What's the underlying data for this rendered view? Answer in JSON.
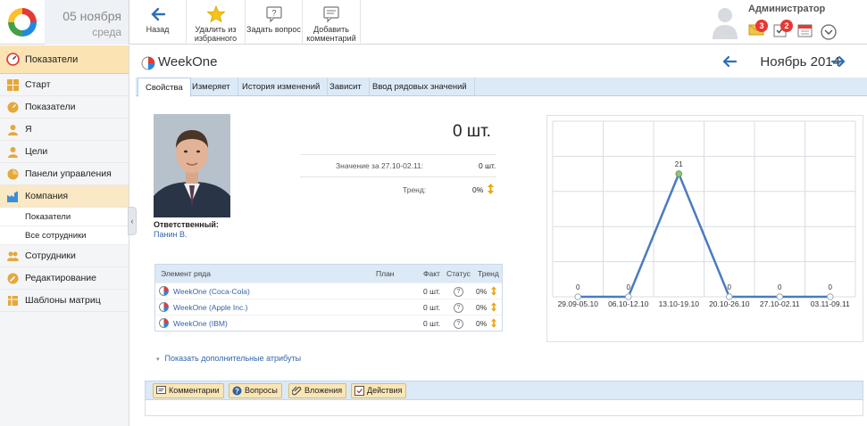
{
  "header": {
    "date": "05 ноября",
    "weekday": "среда",
    "toolbar": {
      "back_label": "Назад",
      "fav_label_1": "Удалить из",
      "fav_label_2": "избранного",
      "ask_label": "Задать вопрос",
      "comment_label_1": "Добавить",
      "comment_label_2": "комментарий"
    },
    "user_name": "Администратор",
    "notifications": {
      "messages": "3",
      "tasks": "2"
    }
  },
  "sidebar": {
    "header": "Показатели",
    "items": [
      {
        "label": "Старт",
        "icon": "grid-icon"
      },
      {
        "label": "Показатели",
        "icon": "gauge-icon"
      },
      {
        "label": "Я",
        "icon": "person-icon"
      },
      {
        "label": "Цели",
        "icon": "target-person-icon"
      },
      {
        "label": "Панели управления",
        "icon": "dashboard-icon"
      },
      {
        "label": "Компания",
        "icon": "factory-icon"
      },
      {
        "label": "Сотрудники",
        "icon": "people-icon"
      },
      {
        "label": "Редактирование",
        "icon": "edit-icon"
      },
      {
        "label": "Шаблоны матриц",
        "icon": "template-icon"
      }
    ],
    "sub_items": [
      "Показатели",
      "Все сотрудники"
    ]
  },
  "main": {
    "title": "WeekOne",
    "period": "Ноябрь 2014",
    "tabs": [
      "Свойства",
      "Измеряет",
      "История изменений",
      "Зависит",
      "Ввод рядовых значений"
    ],
    "responsible_label": "Ответственный:",
    "responsible_name": "Панин В.",
    "big_value": "0 шт.",
    "value_label": "Значение за 27.10-02.11:",
    "value_value": "0 шт.",
    "trend_label": "Тренд:",
    "trend_value": "0%",
    "table": {
      "headers": [
        "Элемент ряда",
        "План",
        "Факт",
        "Статус",
        "Тренд"
      ],
      "rows": [
        {
          "name": "WeekOne (Coca-Cola)",
          "plan": "",
          "fact": "0 шт.",
          "status": "?",
          "trend": "0%"
        },
        {
          "name": "WeekOne (Apple Inc.)",
          "plan": "",
          "fact": "0 шт.",
          "status": "?",
          "trend": "0%"
        },
        {
          "name": "WeekOne (IBM)",
          "plan": "",
          "fact": "0 шт.",
          "status": "?",
          "trend": "0%"
        }
      ]
    },
    "more_attrs": "Показать дополнительные атрибуты",
    "bottom_buttons": [
      "Комментарии",
      "Вопросы",
      "Вложения",
      "Действия"
    ]
  },
  "chart_data": {
    "type": "line",
    "categories": [
      "29.09-05.10",
      "06.10-12.10",
      "13.10-19.10",
      "20.10-26.10",
      "27.10-02.11",
      "03.11-09.11"
    ],
    "values": [
      0,
      0,
      21,
      0,
      0,
      0
    ],
    "labels": [
      "0",
      "0",
      "21",
      "0",
      "0",
      "0"
    ],
    "ylim": [
      0,
      30
    ],
    "grid": true,
    "line_color": "#4a7bbf",
    "highlight_color": "#8fc37a"
  }
}
